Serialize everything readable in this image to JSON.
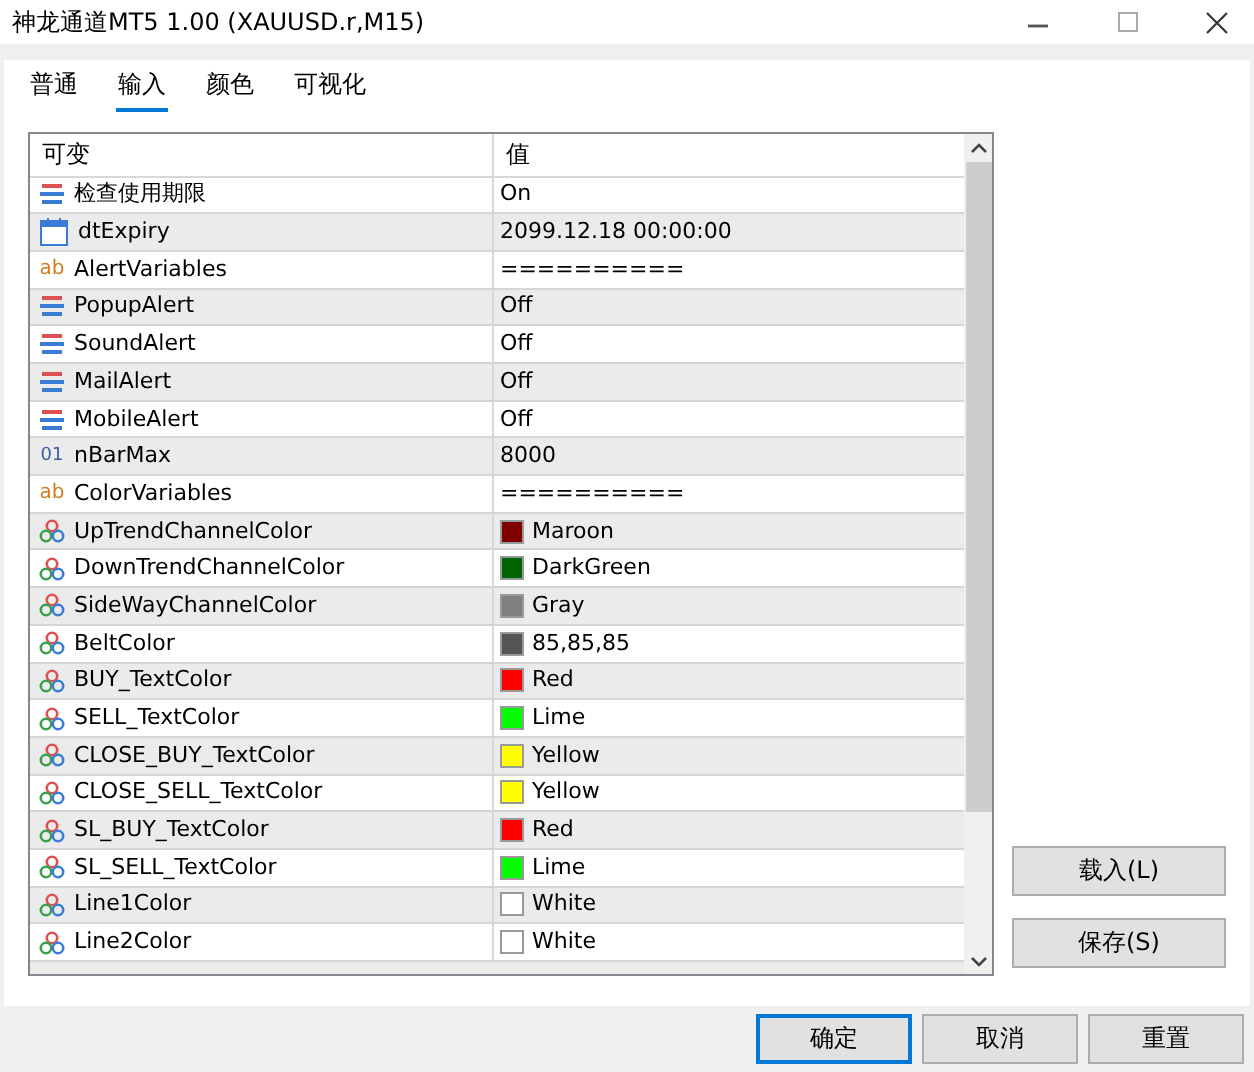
{
  "window": {
    "title": "神龙通道MT5 1.00 (XAUUSD.r,M15)"
  },
  "tabs": [
    {
      "label": "普通",
      "selected": false
    },
    {
      "label": "输入",
      "selected": true
    },
    {
      "label": "颜色",
      "selected": false
    },
    {
      "label": "可视化",
      "selected": false
    }
  ],
  "table": {
    "columns": [
      "可变",
      "值"
    ],
    "rows": [
      {
        "kind": "bool",
        "name": "检查使用期限",
        "value": "On"
      },
      {
        "kind": "datetime",
        "name": "dtExpiry",
        "value": "2099.12.18 00:00:00"
      },
      {
        "kind": "string",
        "icon_text": "ab",
        "name": "AlertVariables",
        "value": "=========="
      },
      {
        "kind": "bool",
        "name": "PopupAlert",
        "value": "Off"
      },
      {
        "kind": "bool",
        "name": "SoundAlert",
        "value": "Off"
      },
      {
        "kind": "bool",
        "name": "MailAlert",
        "value": "Off"
      },
      {
        "kind": "bool",
        "name": "MobileAlert",
        "value": "Off"
      },
      {
        "kind": "int",
        "icon_text": "01",
        "name": "nBarMax",
        "value": "8000"
      },
      {
        "kind": "string",
        "icon_text": "ab",
        "name": "ColorVariables",
        "value": "=========="
      },
      {
        "kind": "color",
        "name": "UpTrendChannelColor",
        "value": "Maroon",
        "color": "#800000"
      },
      {
        "kind": "color",
        "name": "DownTrendChannelColor",
        "value": "DarkGreen",
        "color": "#006400"
      },
      {
        "kind": "color",
        "name": "SideWayChannelColor",
        "value": "Gray",
        "color": "#808080"
      },
      {
        "kind": "color",
        "name": "BeltColor",
        "value": "85,85,85",
        "color": "#555555"
      },
      {
        "kind": "color",
        "name": "BUY_TextColor",
        "value": "Red",
        "color": "#ff0000"
      },
      {
        "kind": "color",
        "name": "SELL_TextColor",
        "value": "Lime",
        "color": "#00ff00"
      },
      {
        "kind": "color",
        "name": "CLOSE_BUY_TextColor",
        "value": "Yellow",
        "color": "#ffff00"
      },
      {
        "kind": "color",
        "name": "CLOSE_SELL_TextColor",
        "value": "Yellow",
        "color": "#ffff00"
      },
      {
        "kind": "color",
        "name": "SL_BUY_TextColor",
        "value": "Red",
        "color": "#ff0000"
      },
      {
        "kind": "color",
        "name": "SL_SELL_TextColor",
        "value": "Lime",
        "color": "#00ff00"
      },
      {
        "kind": "color",
        "name": "Line1Color",
        "value": "White",
        "color": "#ffffff"
      },
      {
        "kind": "color",
        "name": "Line2Color",
        "value": "White",
        "color": "#ffffff"
      }
    ]
  },
  "side_buttons": [
    "载入(L)",
    "保存(S)"
  ],
  "buttons": [
    {
      "label": "确定",
      "default": true
    },
    {
      "label": "取消",
      "default": false
    },
    {
      "label": "重置",
      "default": false
    }
  ]
}
